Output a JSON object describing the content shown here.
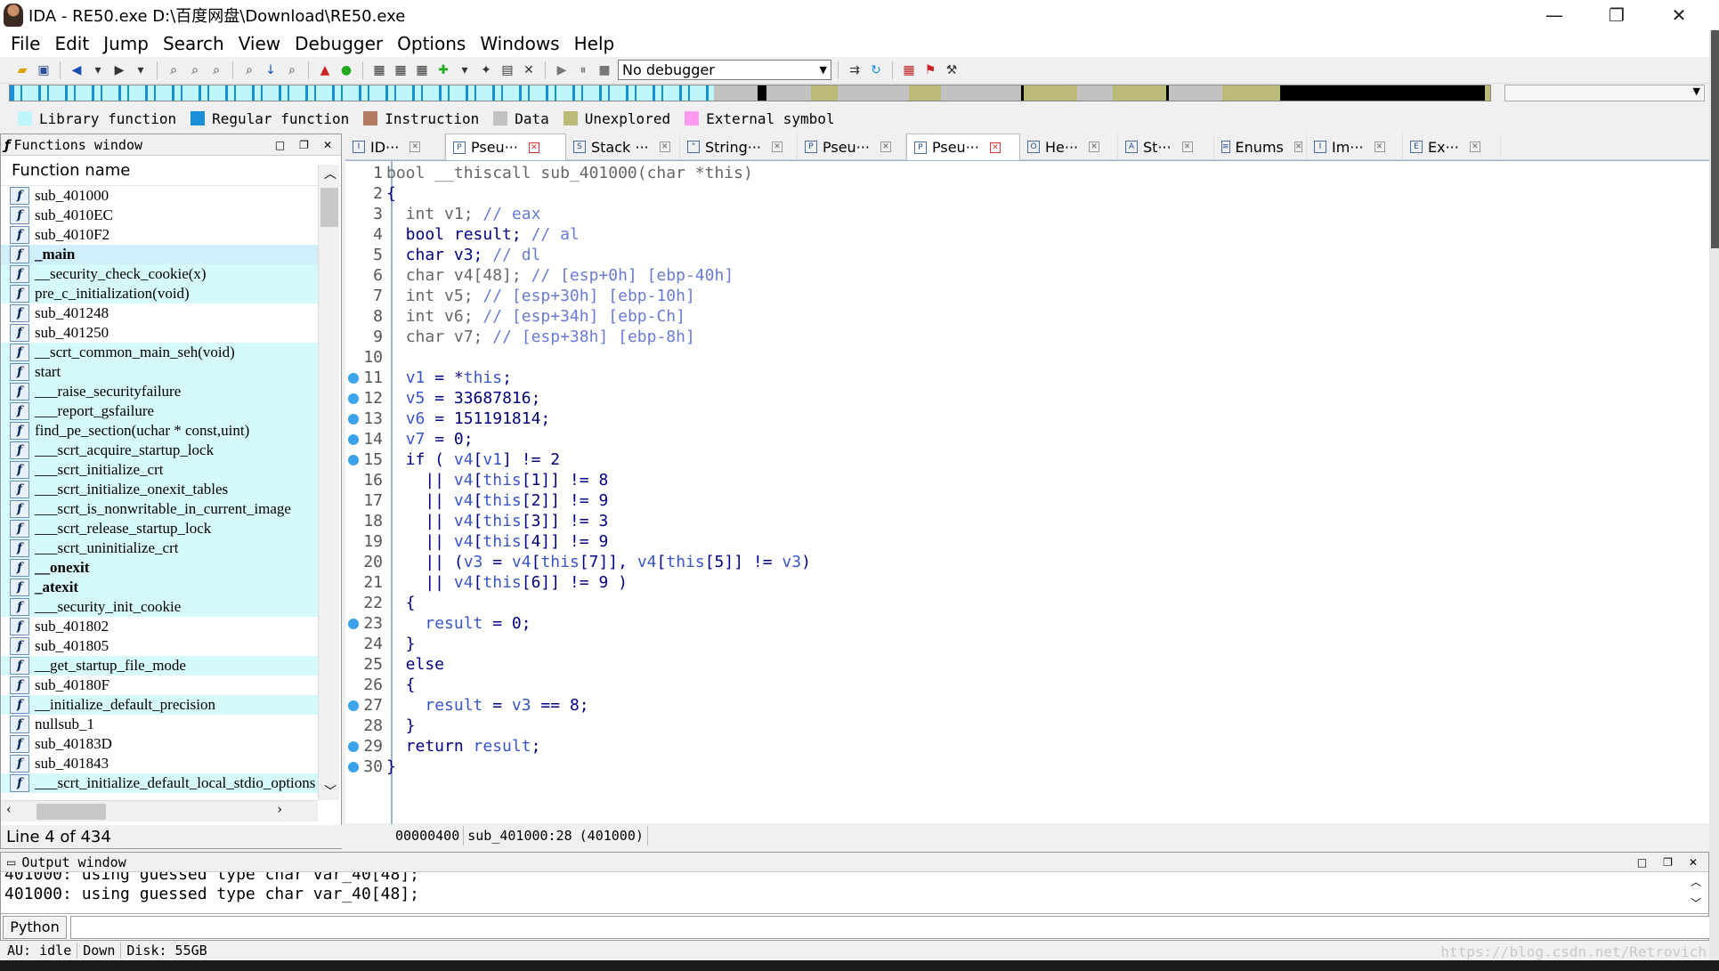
{
  "window": {
    "title": "IDA - RE50.exe D:\\百度网盘\\Download\\RE50.exe",
    "minimize": "—",
    "restore": "❐",
    "close": "✕"
  },
  "menu": [
    "File",
    "Edit",
    "Jump",
    "Search",
    "View",
    "Debugger",
    "Options",
    "Windows",
    "Help"
  ],
  "toolbar": {
    "debugger": "No debugger"
  },
  "legend": [
    {
      "label": "Library function",
      "color": "#bff6fb"
    },
    {
      "label": "Regular function",
      "color": "#1a8ed6"
    },
    {
      "label": "Instruction",
      "color": "#b17c62"
    },
    {
      "label": "Data",
      "color": "#c2c2c2"
    },
    {
      "label": "Unexplored",
      "color": "#bcba77"
    },
    {
      "label": "External symbol",
      "color": "#ff9af0"
    }
  ],
  "functions_window": {
    "title": "Functions window",
    "header": "Function name",
    "status": "Line 4 of 434",
    "items": [
      {
        "name": "sub_401000",
        "lib": false,
        "bold": false
      },
      {
        "name": "sub_4010EC",
        "lib": false,
        "bold": false
      },
      {
        "name": "sub_4010F2",
        "lib": false,
        "bold": false
      },
      {
        "name": "_main",
        "lib": false,
        "bold": true,
        "selected": true
      },
      {
        "name": "__security_check_cookie(x)",
        "lib": true,
        "bold": false
      },
      {
        "name": "pre_c_initialization(void)",
        "lib": true,
        "bold": false
      },
      {
        "name": "sub_401248",
        "lib": false,
        "bold": false
      },
      {
        "name": "sub_401250",
        "lib": false,
        "bold": false
      },
      {
        "name": "__scrt_common_main_seh(void)",
        "lib": true,
        "bold": false
      },
      {
        "name": "start",
        "lib": true,
        "bold": false
      },
      {
        "name": "___raise_securityfailure",
        "lib": true,
        "bold": false
      },
      {
        "name": "___report_gsfailure",
        "lib": true,
        "bold": false
      },
      {
        "name": "find_pe_section(uchar * const,uint)",
        "lib": true,
        "bold": false
      },
      {
        "name": "___scrt_acquire_startup_lock",
        "lib": true,
        "bold": false
      },
      {
        "name": "___scrt_initialize_crt",
        "lib": true,
        "bold": false
      },
      {
        "name": "___scrt_initialize_onexit_tables",
        "lib": true,
        "bold": false
      },
      {
        "name": "___scrt_is_nonwritable_in_current_image",
        "lib": true,
        "bold": false
      },
      {
        "name": "___scrt_release_startup_lock",
        "lib": true,
        "bold": false
      },
      {
        "name": "___scrt_uninitialize_crt",
        "lib": true,
        "bold": false
      },
      {
        "name": "__onexit",
        "lib": true,
        "bold": true
      },
      {
        "name": "_atexit",
        "lib": true,
        "bold": true
      },
      {
        "name": "___security_init_cookie",
        "lib": true,
        "bold": false
      },
      {
        "name": "sub_401802",
        "lib": false,
        "bold": false
      },
      {
        "name": "sub_401805",
        "lib": false,
        "bold": false
      },
      {
        "name": "__get_startup_file_mode",
        "lib": true,
        "bold": false
      },
      {
        "name": "sub_40180F",
        "lib": false,
        "bold": false
      },
      {
        "name": "__initialize_default_precision",
        "lib": true,
        "bold": false
      },
      {
        "name": "nullsub_1",
        "lib": false,
        "bold": false
      },
      {
        "name": "sub_40183D",
        "lib": false,
        "bold": false
      },
      {
        "name": "sub_401843",
        "lib": false,
        "bold": false
      },
      {
        "name": "___scrt_initialize_default_local_stdio_options",
        "lib": true,
        "bold": false
      }
    ]
  },
  "tabs": [
    {
      "label": "ID···",
      "icon": "I",
      "active": false
    },
    {
      "label": "Pseu···",
      "icon": "P",
      "active": true
    },
    {
      "label": "Stack ···",
      "icon": "S",
      "active": false
    },
    {
      "label": "String···",
      "icon": "\"",
      "active": false
    },
    {
      "label": "Pseu···",
      "icon": "P",
      "active": false
    },
    {
      "label": "Pseu···",
      "icon": "P",
      "active": true
    },
    {
      "label": "He···",
      "icon": "O",
      "active": false
    },
    {
      "label": "St···",
      "icon": "A",
      "active": false
    },
    {
      "label": "Enums",
      "icon": "≡",
      "active": false
    },
    {
      "label": "Im···",
      "icon": "I",
      "active": false
    },
    {
      "label": "Ex···",
      "icon": "E",
      "active": false
    }
  ],
  "code_status": {
    "addr": "00000400",
    "loc": "sub_401000:28",
    "ea": "(401000)"
  },
  "output": {
    "title": "Output window",
    "lines": [
      "401000: using guessed type char var_40[48];",
      "401000: using guessed type char var_40[48];"
    ],
    "python_button": "Python"
  },
  "statusbar": {
    "au": "AU:  idle",
    "dir": "Down",
    "disk": "Disk: 55GB"
  },
  "watermark": "https://blog.csdn.net/Retrovich"
}
